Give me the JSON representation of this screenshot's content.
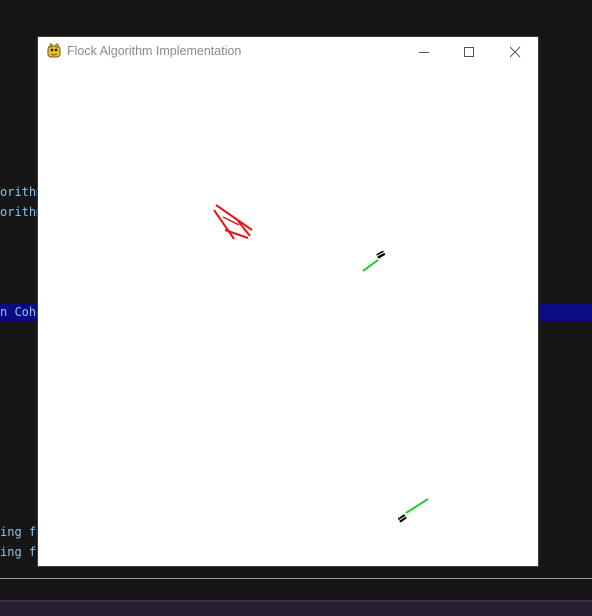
{
  "window": {
    "title": "Flock Algorithm Implementation",
    "icon": "pygame-snake-icon",
    "controls": {
      "minimize": "minimize-icon",
      "maximize": "maximize-icon",
      "close": "close-icon"
    }
  },
  "background_terminal": {
    "lines": [
      "orithm",
      "orithm",
      "n Cohe",
      "ing fo",
      "ing fo"
    ],
    "highlight_color": "#0a0b82",
    "text_color": "#8fc2e8"
  },
  "boids": [
    {
      "name": "boid-red-cluster",
      "color": "#e01818",
      "body_color": "#e01818"
    },
    {
      "name": "boid-green-1",
      "color": "#22cc22",
      "body_color": "#000000"
    },
    {
      "name": "boid-green-2",
      "color": "#22cc22",
      "body_color": "#000000"
    }
  ]
}
